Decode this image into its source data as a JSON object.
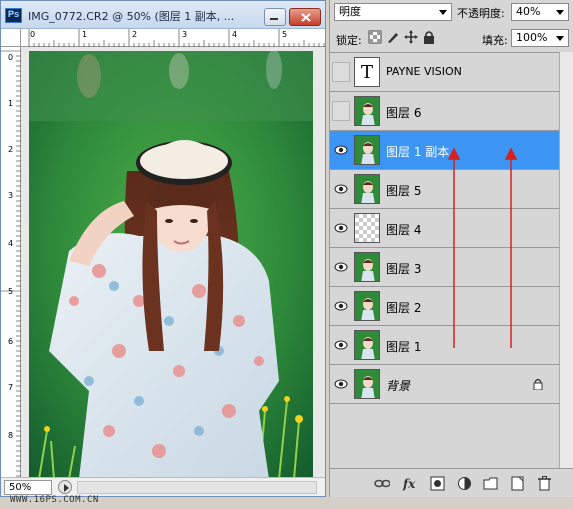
{
  "document": {
    "title": "IMG_0772.CR2 @ 50% (图层 1 副本, ...",
    "zoom": "50%",
    "ruler_h": [
      "0",
      "1",
      "2",
      "3",
      "4",
      "5"
    ],
    "ruler_v": [
      "0",
      "1",
      "2",
      "3",
      "4",
      "5",
      "6",
      "7",
      "8"
    ]
  },
  "layers_panel": {
    "blend_mode": "明度",
    "opacity_label": "不透明度:",
    "opacity_value": "40%",
    "lock_label": "锁定:",
    "fill_label": "填充:",
    "fill_value": "100%",
    "layers": [
      {
        "name": "PAYNE VISION",
        "type": "text",
        "visible": false,
        "selected": false
      },
      {
        "name": "图层 6",
        "type": "image",
        "visible": false,
        "selected": false
      },
      {
        "name": "图层 1 副本",
        "type": "image",
        "visible": true,
        "selected": true
      },
      {
        "name": "图层 5",
        "type": "image",
        "visible": true,
        "selected": false
      },
      {
        "name": "图层 4",
        "type": "transparent",
        "visible": true,
        "selected": false
      },
      {
        "name": "图层 3",
        "type": "image",
        "visible": true,
        "selected": false
      },
      {
        "name": "图层 2",
        "type": "image",
        "visible": true,
        "selected": false
      },
      {
        "name": "图层 1",
        "type": "image",
        "visible": true,
        "selected": false
      },
      {
        "name": "背景",
        "type": "image",
        "visible": true,
        "selected": false,
        "locked": true,
        "italic": true
      }
    ],
    "text_layer_glyph": "T"
  },
  "watermark": "WWW.16PS.COM.CN",
  "colors": {
    "selected_row": "#3d95f3",
    "annotation_arrows": "#d62020"
  }
}
